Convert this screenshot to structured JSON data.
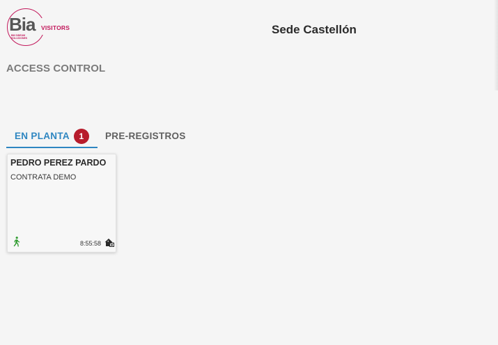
{
  "brand": {
    "logo_word": "Bia",
    "logo_tagline": "BM SIDEUM SOLUCIONES",
    "logo_sub": "VISITORS",
    "accent_color": "#c2185b"
  },
  "header": {
    "site_title": "Sede Castellón"
  },
  "page": {
    "heading": "ACCESS CONTROL"
  },
  "tabs": [
    {
      "label": "EN PLANTA",
      "badge": "1",
      "active": true
    },
    {
      "label": "PRE-REGISTROS",
      "active": false
    }
  ],
  "colors": {
    "tab_active": "#2e86c1",
    "badge_bg": "#b71c2c",
    "walk_icon": "#2e9b2e"
  },
  "visitors": [
    {
      "name": "PEDRO PEREZ PARDO",
      "company": "CONTRATA DEMO",
      "time": "8:55:58",
      "status_icon": "walking-person-icon",
      "location_icon": "home-building-icon"
    }
  ]
}
